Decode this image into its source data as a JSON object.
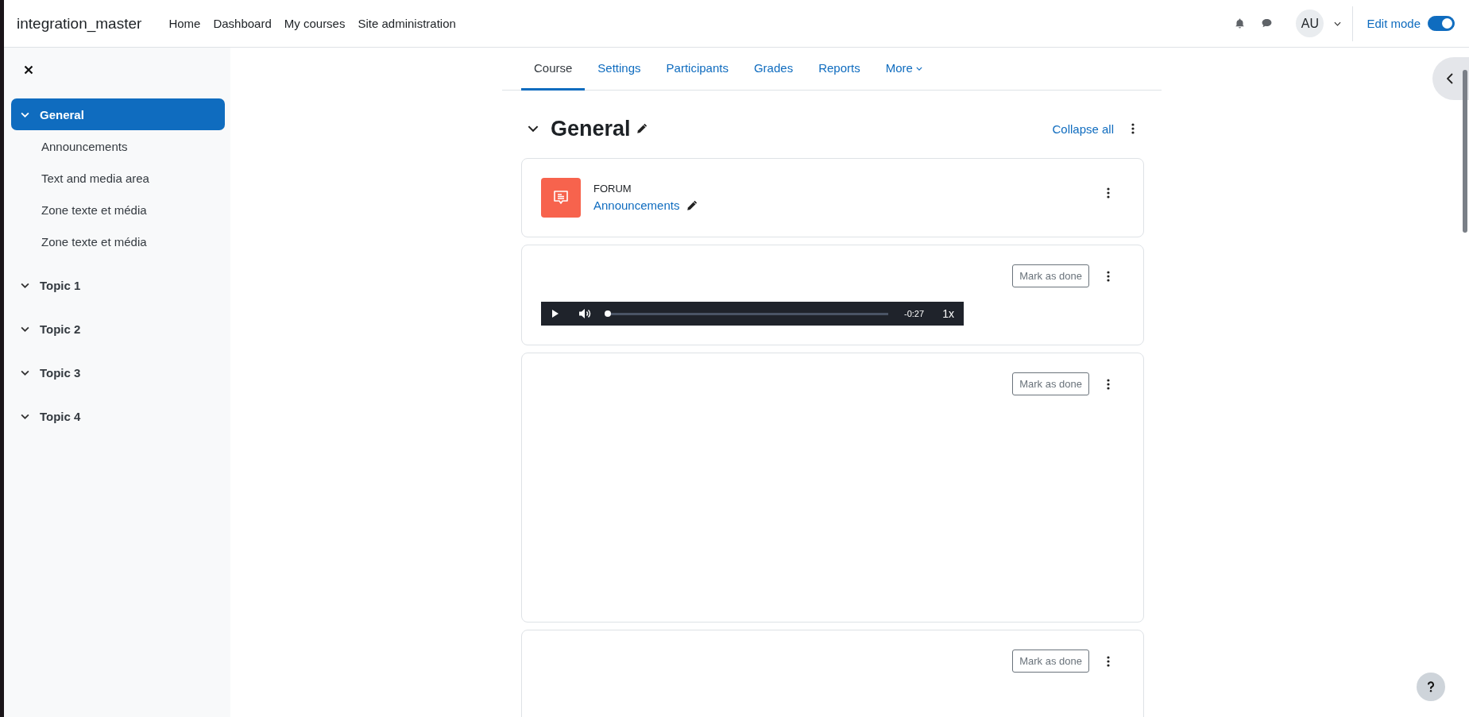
{
  "navbar": {
    "brand": "integration_master",
    "links": [
      "Home",
      "Dashboard",
      "My courses",
      "Site administration"
    ],
    "avatar": "AU",
    "edit_mode": {
      "label": "Edit mode",
      "on": true
    }
  },
  "sidebar": {
    "items": [
      {
        "label": "General",
        "selected": true,
        "children": [
          {
            "label": "Announcements",
            "selected": false
          },
          {
            "label": "Text and media area",
            "selected": false
          },
          {
            "label": "Zone texte et média",
            "selected": false
          },
          {
            "label": "Zone texte et média",
            "selected": false
          }
        ]
      },
      {
        "label": "Topic 1",
        "selected": false
      },
      {
        "label": "Topic 2",
        "selected": false
      },
      {
        "label": "Topic 3",
        "selected": false
      },
      {
        "label": "Topic 4",
        "selected": false
      }
    ]
  },
  "course_tabs": [
    {
      "label": "Course",
      "selected": true
    },
    {
      "label": "Settings",
      "selected": false
    },
    {
      "label": "Participants",
      "selected": false
    },
    {
      "label": "Grades",
      "selected": false
    },
    {
      "label": "Reports",
      "selected": false
    },
    {
      "label": "More",
      "selected": false
    }
  ],
  "section": {
    "title": "General",
    "collapse_all": "Collapse all"
  },
  "activities": [
    {
      "kind": "forum",
      "type_label": "FORUM",
      "name": "Announcements"
    },
    {
      "kind": "audio",
      "button": "Mark as done",
      "player": {
        "time": "-0:27",
        "speed": "1x",
        "level": 0
      }
    },
    {
      "kind": "blank",
      "button": "Mark as done"
    },
    {
      "kind": "blank",
      "button": "Mark as done"
    }
  ]
}
